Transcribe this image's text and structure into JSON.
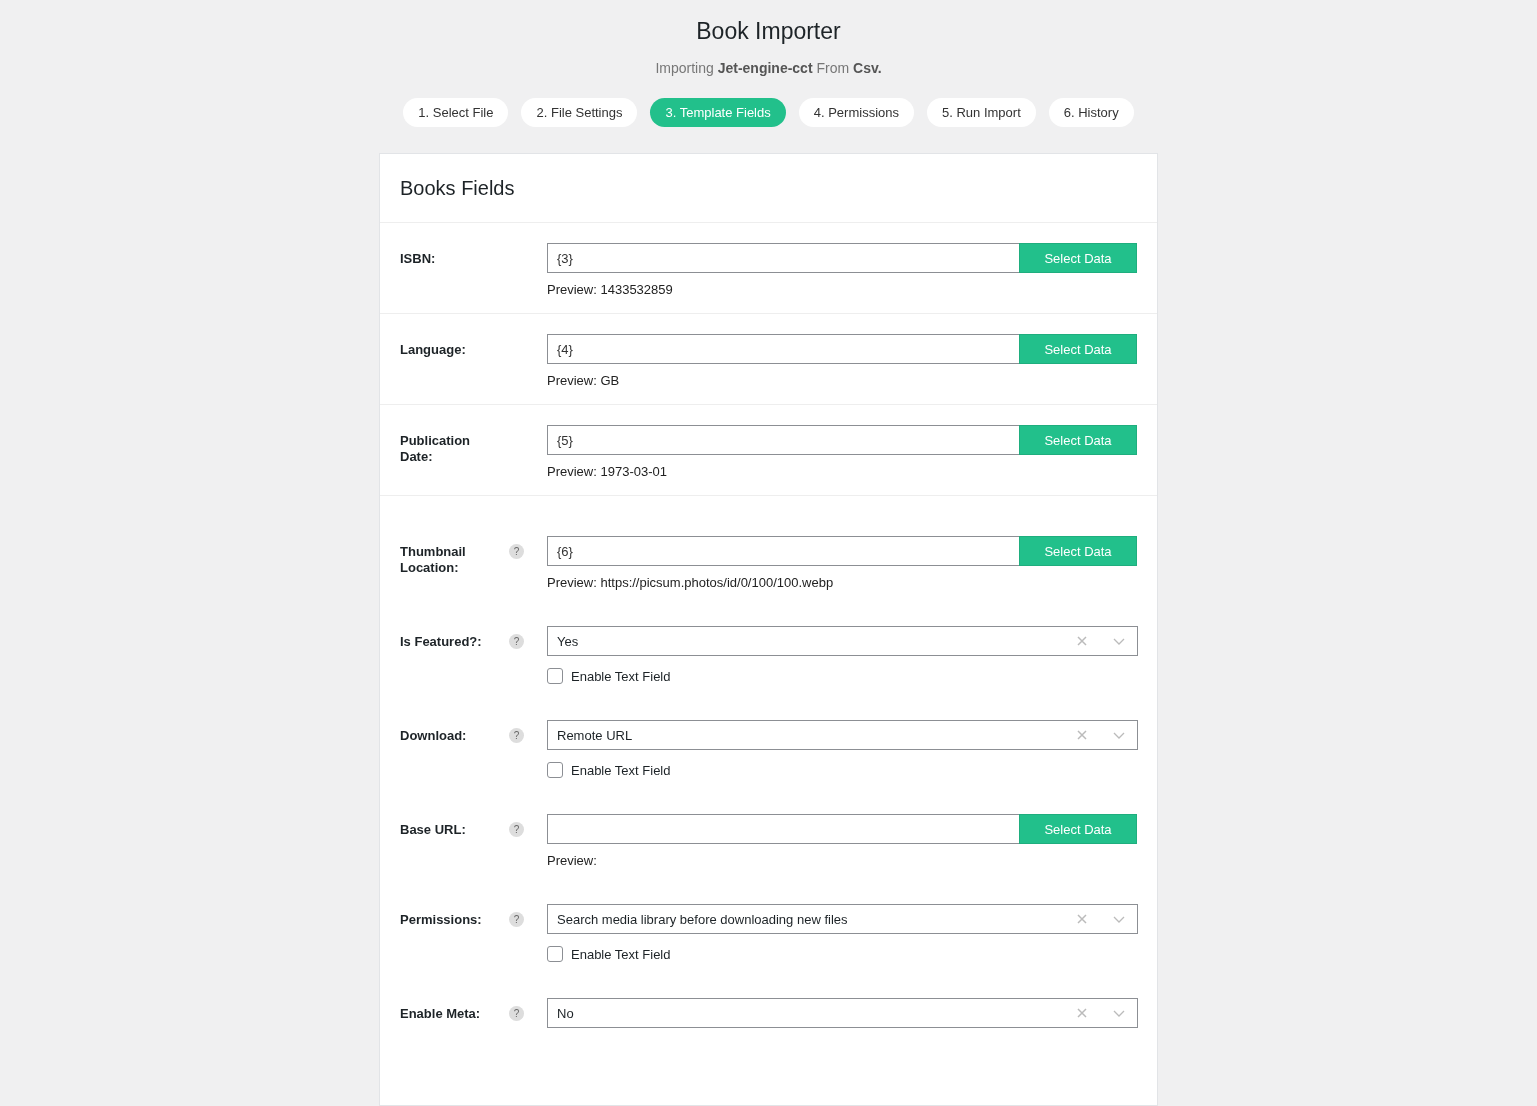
{
  "header": {
    "title": "Book Importer",
    "subtitle": "Importing **Jet-engine-cct** From **Csv.**"
  },
  "tabs": [
    {
      "label": "1. Select File",
      "selected": false
    },
    {
      "label": "2. File Settings",
      "selected": false
    },
    {
      "label": "3. Template Fields",
      "selected": true
    },
    {
      "label": "4. Permissions",
      "selected": false
    },
    {
      "label": "5. Run Import",
      "selected": false
    },
    {
      "label": "6. History",
      "selected": false
    }
  ],
  "panel": {
    "title": "Books Fields",
    "sections": [
      {
        "fields": [
          {
            "kind": "data",
            "label": "ISBN:",
            "value": "{3}",
            "button": "Select Data",
            "preview": "Preview: 1433532859"
          }
        ]
      },
      {
        "fields": [
          {
            "kind": "data",
            "label": "Language:",
            "value": "{4}",
            "button": "Select Data",
            "preview": "Preview: GB"
          }
        ]
      },
      {
        "fields": [
          {
            "kind": "data",
            "label": "Publication Date:",
            "value": "{5}",
            "button": "Select Data",
            "preview": "Preview: 1973-03-01"
          }
        ]
      },
      {
        "fields": [
          {
            "kind": "data",
            "label": "Thumbnail Location:",
            "help": "?",
            "value": "{6}",
            "button": "Select Data",
            "preview": "Preview: https://picsum.photos/id/0/100/100.webp"
          },
          {
            "kind": "select",
            "label": "Is Featured?:",
            "help": "?",
            "value": "Yes",
            "checkbox": {
              "label": "Enable Text Field",
              "checked": false
            }
          },
          {
            "kind": "select",
            "label": "Download:",
            "help": "?",
            "value": "Remote URL",
            "checkbox": {
              "label": "Enable Text Field",
              "checked": false
            }
          },
          {
            "kind": "data",
            "label": "Base URL:",
            "help": "?",
            "button": "Select Data",
            "preview": "Preview:"
          },
          {
            "kind": "select",
            "label": "Permissions:",
            "help": "?",
            "value": "Search media library before downloading new files",
            "checkbox": {
              "label": "Enable Text Field",
              "checked": false
            }
          },
          {
            "kind": "select",
            "label": "Enable Meta:",
            "help": "?",
            "value": "No"
          }
        ]
      }
    ]
  }
}
